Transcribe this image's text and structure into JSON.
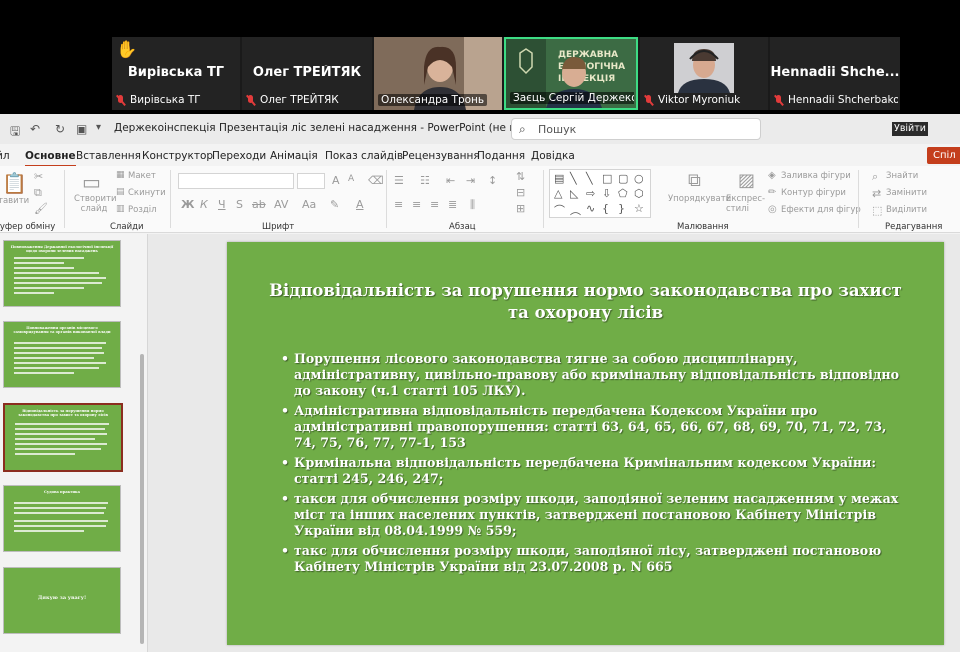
{
  "zoom": {
    "participants": [
      {
        "big_name": "Вирівська ТГ",
        "label": "Вирівська ТГ",
        "hand_raised": true
      },
      {
        "big_name": "Олег ТРЕЙТЯК",
        "label": "Олег ТРЕЙТЯК"
      },
      {
        "label": "Олександра Тронь",
        "video": true
      },
      {
        "label": "Заєць Сергій Держекоінс...",
        "video": true,
        "active_speaker": true
      },
      {
        "label": "Viktor Myroniuk",
        "video": true
      },
      {
        "big_name": "Hennadii Shche...",
        "label": "Hennadii Shcherbakov"
      }
    ]
  },
  "ppt": {
    "doc_title": "Держекоінспекція Презентація ліс зелені насадження  -  PowerPoint (не вдалося активувати прод...",
    "search_placeholder": "Пошук",
    "signin_label": "Увійти",
    "share_label": "Спіл",
    "tabs": [
      "йл",
      "Основне",
      "Вставлення",
      "Конструктор",
      "Переходи",
      "Анімація",
      "Показ слайдів",
      "Рецензування",
      "Подання",
      "Довідка"
    ],
    "active_tab": "Основне",
    "ribbon": {
      "groups": {
        "clipboard": "Буфер обміну",
        "slides": "Слайди",
        "font": "Шрифт",
        "paragraph": "Абзац",
        "drawing": "Малювання",
        "editing": "Редагування"
      },
      "paste_label": "тавити",
      "new_slide_label": "Створити слайд",
      "layout_label": "Макет",
      "reset_label": "Скинути",
      "section_label": "Розділ",
      "arrange_label": "Упорядкувати",
      "quick_styles_label": "Експрес-стилі",
      "shape_fill_label": "Заливка фігури",
      "shape_outline_label": "Контур фігури",
      "shape_effects_label": "Ефекти для фігур",
      "find_label": "Знайти",
      "replace_label": "Замінити",
      "select_label": "Виділити"
    },
    "thumbnails": [
      {
        "title": "Повноваження Державної екологічної інспекції щодо охорони зелених насаджень",
        "lines": 8
      },
      {
        "title": "Повноваження органів місцевого самоврядування та органів виконавчої влади",
        "lines": 7
      },
      {
        "title": "Відповідальність за порушення нормо законодавства про захист та охорону лісів",
        "lines": 7,
        "selected": true
      },
      {
        "title": "Судова практика",
        "lines": 6
      },
      {
        "center_text": "Дякую за увагу!"
      }
    ],
    "slide": {
      "title": "Відповідальність за порушення нормо законодавства про захист та охорону лісів",
      "bullets": [
        "Порушення лісового законодавства тягне за собою дисциплінарну, адміністративну, цивільно-правову або кримінальну відповідальність відповідно до закону (ч.1 статті 105 ЛКУ).",
        "Адміністративна відповідальність  передбачена Кодексом України про адміністративні правопорушення: статті 63, 64, 65, 66, 67, 68, 69, 70, 71, 72, 73, 74, 75, 76, 77, 77-1, 153",
        "Кримінальна відповідальність передбачена Кримінальним кодексом України: статті 245, 246, 247;",
        "такси для обчислення розміру шкоди, заподіяної зеленим насадженням у межах міст та інших населених пунктів, затверджені постановою Кабінету Міністрів України від 08.04.1999 № 559;",
        "такс для обчислення розміру шкоди, заподіяної лісу, затверджені постановою Кабінету Міністрів України від 23.07.2008 р. N 665"
      ]
    }
  },
  "colors": {
    "slide_green": "#70ad47",
    "accent_red": "#c43e1c",
    "active_speaker": "#3ddc84"
  }
}
